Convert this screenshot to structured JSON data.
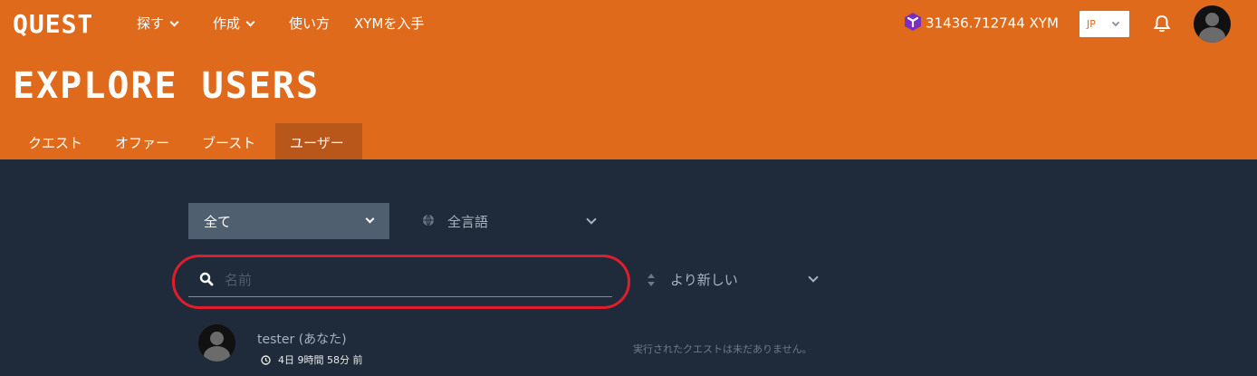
{
  "header": {
    "logo": "QUEST",
    "nav": [
      {
        "label": "探す",
        "has_dropdown": true
      },
      {
        "label": "作成",
        "has_dropdown": true
      },
      {
        "label": "使い方",
        "has_dropdown": false
      },
      {
        "label": "XYMを入手",
        "has_dropdown": false
      }
    ],
    "balance": "31436.712744 XYM",
    "language": "JP",
    "page_title": "EXPLORE USERS",
    "tabs": [
      {
        "label": "クエスト",
        "active": false
      },
      {
        "label": "オファー",
        "active": false
      },
      {
        "label": "ブースト",
        "active": false
      },
      {
        "label": "ユーザー",
        "active": true
      }
    ]
  },
  "filters": {
    "category": "全て",
    "language": "全言語",
    "sort": "より新しい"
  },
  "search": {
    "value": "",
    "placeholder": "名前"
  },
  "users": [
    {
      "name": "tester (あなた)",
      "time": "4日 9時間 58分 前",
      "quests": "実行されたクエストは未だありません。"
    }
  ],
  "colors": {
    "header_bg": "#e06a1c",
    "active_tab_bg": "#b9561a",
    "content_bg": "#1f2b3a",
    "select_bg": "#4f5f70",
    "highlight": "#e01e2b",
    "token_icon": "#7b2fbe"
  },
  "icons": [
    "symbol-token-icon",
    "chevron-down-icon",
    "bell-icon",
    "avatar-icon",
    "globe-icon",
    "search-icon",
    "sort-arrows-icon",
    "clock-icon"
  ]
}
